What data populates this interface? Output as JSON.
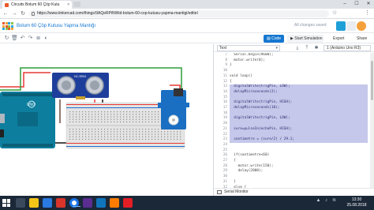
{
  "browser": {
    "tab_title": "Circuits Bolum 60 Çöp Kutu",
    "tab_close": "×",
    "url": "https://www.tinkercad.com/things/9AQeRPiNWid-bolum-60-cop-kutusu-yapma-mantigi/editel",
    "window_controls": [
      "–",
      "☐",
      "✕"
    ]
  },
  "header": {
    "design_title": "Bolum 60 Çöp Kutusu Yapma Mantığı",
    "save_status": "All changes saved"
  },
  "toolbar": {
    "code_label": "Code",
    "simulate_label": "Start Simulation",
    "export_label": "Export",
    "share_label": "Share"
  },
  "code_panel": {
    "mode": "Text",
    "board": "1 (Arduino Uno R3)",
    "serial_monitor": "Serial Monitor",
    "lines": [
      {
        "n": "7",
        "t": "  Serial.begin(9600);"
      },
      {
        "n": "8",
        "t": "  motor.write(0);"
      },
      {
        "n": "9",
        "t": "}"
      },
      {
        "n": "10",
        "t": ""
      },
      {
        "n": "11",
        "t": "void loop()"
      },
      {
        "n": "12",
        "t": "{"
      },
      {
        "n": "13",
        "t": "  digitalWrite(trigPin, LOW);"
      },
      {
        "n": "14",
        "t": "  delayMicroseconds(2);"
      },
      {
        "n": "15",
        "t": ""
      },
      {
        "n": "16",
        "t": "  digitalWrite(trigPin, HIGH);"
      },
      {
        "n": "17",
        "t": "  delayMicroseconds(10);"
      },
      {
        "n": "18",
        "t": ""
      },
      {
        "n": "19",
        "t": "  digitalWrite(trigPin, LOW);"
      },
      {
        "n": "20",
        "t": ""
      },
      {
        "n": "21",
        "t": "  sure=pulseIn(echoPin, HIGH);"
      },
      {
        "n": "22",
        "t": ""
      },
      {
        "n": "23",
        "t": "  santimetre = (sure/2) / 29.1;"
      },
      {
        "n": "24",
        "t": ""
      },
      {
        "n": "25",
        "t": ""
      },
      {
        "n": "26",
        "t": "  if(santimetre<60)"
      },
      {
        "n": "27",
        "t": "  {"
      },
      {
        "n": "28",
        "t": "    motor.write(150);"
      },
      {
        "n": "29",
        "t": "    delay(2000);"
      },
      {
        "n": "30",
        "t": ""
      },
      {
        "n": "31",
        "t": "  }"
      },
      {
        "n": "32",
        "t": "  else {"
      },
      {
        "n": "33",
        "t": "    motor.write(0);"
      },
      {
        "n": "34",
        "t": "    delay(10);"
      },
      {
        "n": "35",
        "t": "  }"
      }
    ]
  },
  "circuit": {
    "arduino_label": "UNO",
    "arduino_brand": "ARDUINO",
    "sensor_label": "HC-SR04"
  },
  "taskbar": {
    "time": "13:30",
    "date": "25.08.2018"
  },
  "colors": {
    "accent": "#1477d1",
    "highlight": "#c5c8ea",
    "arduino": "#0d7e9e",
    "breadboard": "#e4e4e4",
    "sensor": "#1e3e9b",
    "servo": "#1a6fc2"
  }
}
